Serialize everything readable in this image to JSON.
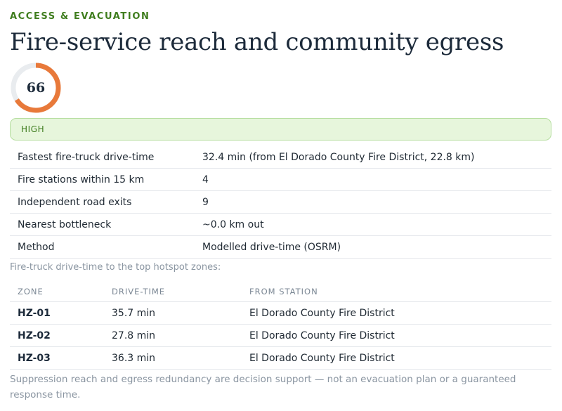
{
  "section": {
    "eyebrow": "ACCESS & EVACUATION",
    "title": "Fire-service reach and community egress"
  },
  "score": {
    "value": "66",
    "fraction": 0.66,
    "ring_color": "#e8793a",
    "track_color": "#e9ecef",
    "level_label": "HIGH",
    "level_color": "#3c7a1c"
  },
  "summary": {
    "rows": [
      {
        "label": "Fastest fire-truck drive-time",
        "value": "32.4 min (from El Dorado County Fire District, 22.8 km)"
      },
      {
        "label": "Fire stations within 15 km",
        "value": "4"
      },
      {
        "label": "Independent road exits",
        "value": "9"
      },
      {
        "label": "Nearest bottleneck",
        "value": "~0.0 km out"
      },
      {
        "label": "Method",
        "value": "Modelled drive-time (OSRM)"
      }
    ]
  },
  "hotspots": {
    "caption": "Fire-truck drive-time to the top hotspot zones:",
    "columns": [
      "ZONE",
      "DRIVE-TIME",
      "FROM STATION"
    ],
    "rows": [
      {
        "zone": "HZ-01",
        "drive_time": "35.7 min",
        "station": "El Dorado County Fire District"
      },
      {
        "zone": "HZ-02",
        "drive_time": "27.8 min",
        "station": "El Dorado County Fire District"
      },
      {
        "zone": "HZ-03",
        "drive_time": "36.3 min",
        "station": "El Dorado County Fire District"
      }
    ]
  },
  "footnote": "Suppression reach and egress redundancy are decision support — not an evacuation plan or a guaranteed response time."
}
